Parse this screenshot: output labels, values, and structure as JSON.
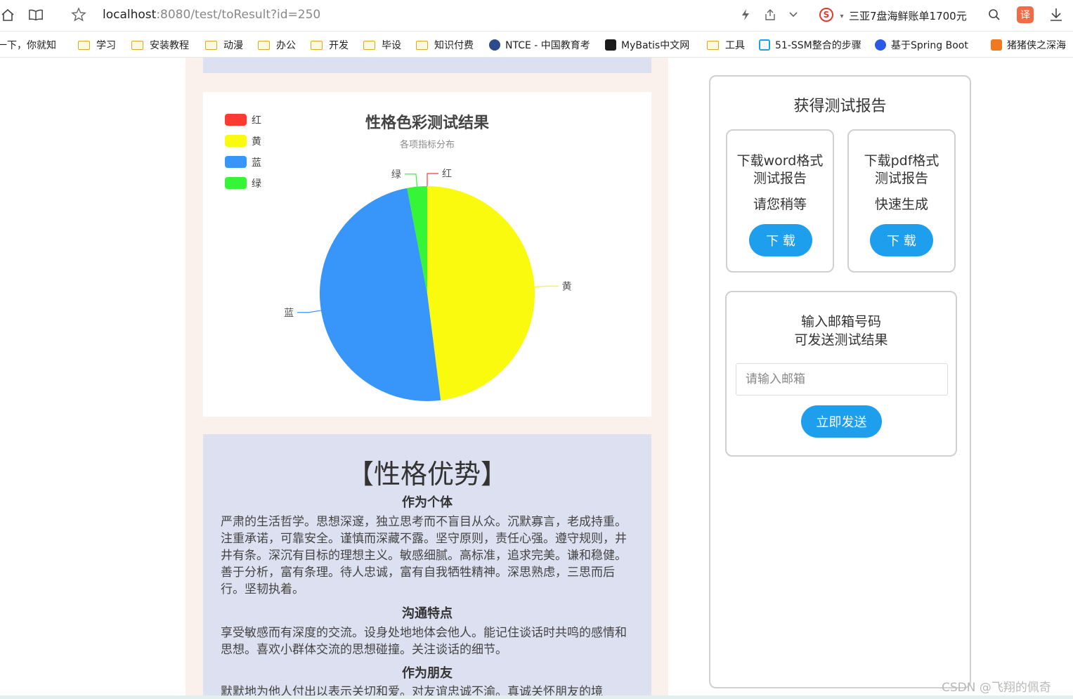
{
  "browser": {
    "url_host": "localhost",
    "url_rest": ":8080/test/toResult?id=250",
    "news_text": "三亚7盘海鲜账单1700元",
    "translate_label": "译"
  },
  "bookmarks": [
    {
      "label": "一下，你就知",
      "type": "folder-less"
    },
    {
      "label": "学习",
      "type": "folder"
    },
    {
      "label": "安装教程",
      "type": "folder"
    },
    {
      "label": "动漫",
      "type": "folder"
    },
    {
      "label": "办公",
      "type": "folder"
    },
    {
      "label": "开发",
      "type": "folder"
    },
    {
      "label": "毕设",
      "type": "folder"
    },
    {
      "label": "知识付费",
      "type": "folder"
    },
    {
      "label": "NTCE - 中国教育考",
      "type": "site"
    },
    {
      "label": "MyBatis中文网",
      "type": "site"
    },
    {
      "label": "工具",
      "type": "folder"
    },
    {
      "label": "51-SSM整合的步骤",
      "type": "site"
    },
    {
      "label": "基于Spring Boot",
      "type": "site"
    },
    {
      "label": "猪猪侠之深海",
      "type": "site"
    }
  ],
  "chart_data": {
    "type": "pie",
    "title": "性格色彩测试结果",
    "subtitle": "各项指标分布",
    "legend_position": "top-left",
    "categories": [
      "红",
      "黄",
      "蓝",
      "绿"
    ],
    "values": [
      0,
      48,
      49,
      3
    ],
    "colors": [
      "#ff3b2f",
      "#fafa0f",
      "#3895f9",
      "#36f536"
    ]
  },
  "advantages": {
    "title": "【性格优势】",
    "sections": [
      {
        "heading": "作为个体",
        "text": "严肃的生活哲学。思想深邃，独立思考而不盲目从众。沉默寡言，老成持重。注重承诺，可靠安全。谨慎而深藏不露。坚守原则，责任心强。遵守规则，井井有条。深沉有目标的理想主义。敏感细腻。高标准，追求完美。谦和稳健。善于分析，富有条理。待人忠诚，富有自我牺牲精神。深思熟虑，三思而后行。坚韧执着。"
      },
      {
        "heading": "沟通特点",
        "text": "享受敏感而有深度的交流。设身处地地体会他人。能记住谈话时共鸣的感情和思想。喜欢小群体交流的思想碰撞。关注谈话的细节。"
      },
      {
        "heading": "作为朋友",
        "text": "默默地为他人付出以表示关切和爱。对友谊忠诚不渝。真诚关怀朋友的境"
      }
    ]
  },
  "report": {
    "title": "获得测试报告",
    "word": {
      "line1": "下载word格式",
      "line2": "测试报告",
      "note": "请您稍等",
      "button": "下 载"
    },
    "pdf": {
      "line1": "下载pdf格式",
      "line2": "测试报告",
      "note": "快速生成",
      "button": "下 载"
    },
    "email": {
      "line1": "输入邮箱号码",
      "line2": "可发送测试结果",
      "placeholder": "请输入邮箱",
      "button": "立即发送"
    }
  },
  "watermark": "CSDN @飞翔的佩奇"
}
